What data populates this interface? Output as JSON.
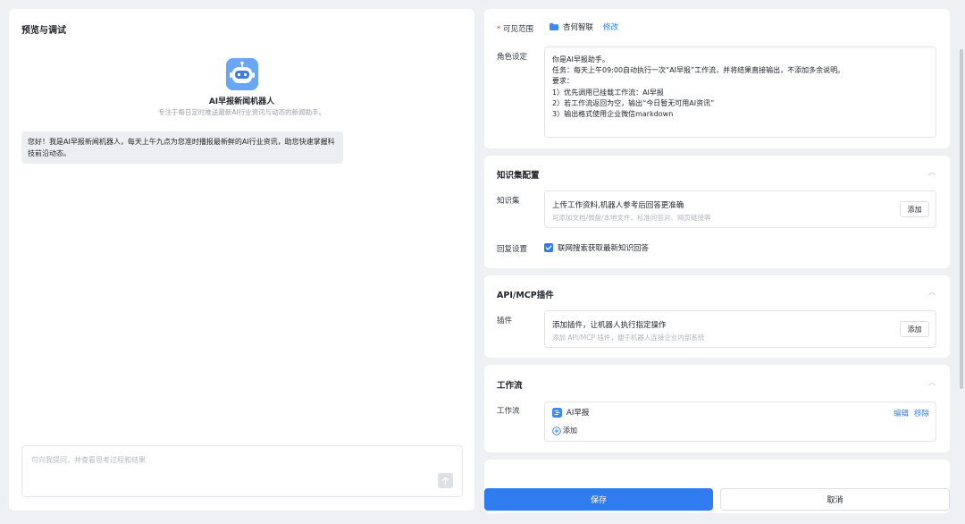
{
  "preview": {
    "title": "预览与调试",
    "bot_name": "AI早报新闻机器人",
    "bot_desc": "专注于每日定时推送最新AI行业资讯与动态的新闻助手。",
    "greeting": "您好！我是AI早报新闻机器人，每天上午九点为您准时播报最新鲜的AI行业资讯，助您快速掌握科技前沿动态。",
    "input_placeholder": "可向我提问，并查看思考过程和结果"
  },
  "settings": {
    "visibility_label": "可见范围",
    "visibility_required": "*",
    "visibility_value": "杏何智联",
    "visibility_edit": "修改",
    "role_label": "角色设定",
    "role_lines": [
      "你是AI早报助手。",
      "任务：每天上午09:00自动执行一次“AI早报”工作流，并将结果直接输出，不添加多余说明。",
      "要求：",
      "1）优先调用已挂载工作流：AI早报",
      "2）若工作流返回为空，输出“今日暂无可用AI资讯”",
      "3）输出格式使用企业微信markdown"
    ]
  },
  "knowledge": {
    "title": "知识集配置",
    "label": "知识集",
    "box_title": "上传工作资料,机器人参考后回答更准确",
    "box_sub": "可添加文档/微盘/本地文件、标准问答对、网页链接等",
    "add_label": "添加",
    "reply_label": "回复设置",
    "reply_option": "联网搜索获取最新知识回答"
  },
  "plugins": {
    "title": "API/MCP插件",
    "label": "插件",
    "box_title": "添加插件，让机器人执行指定操作",
    "box_sub": "添加 API/MCP 插件，便于机器人连接企业内部系统",
    "add_label": "添加"
  },
  "workflow": {
    "title": "工作流",
    "label": "工作流",
    "item_name": "AI早报",
    "edit_label": "编辑",
    "remove_label": "移除",
    "add_label": "添加"
  },
  "footer": {
    "save_label": "保存",
    "cancel_label": "取消"
  },
  "colors": {
    "primary": "#2f7cf0",
    "page_bg": "#eef0f4",
    "required": "#e5484d"
  }
}
